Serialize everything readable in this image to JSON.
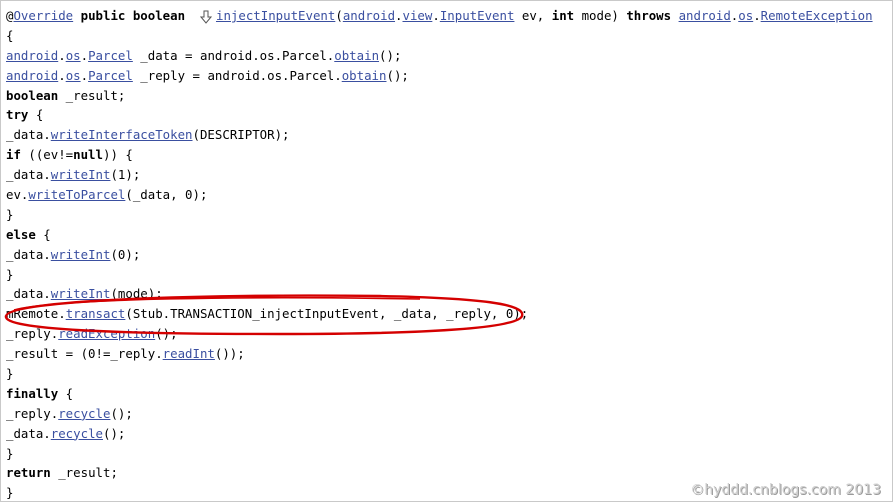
{
  "signature": {
    "annotation": "@",
    "override": "Override",
    "modifiers": "public boolean",
    "method": "injectInputEvent",
    "paren_open": "(",
    "param_pkg1": "android",
    "param_pkg2": "view",
    "param_type": "InputEvent",
    "param_rest": " ev, ",
    "int_kw": "int",
    "mode_param": " mode) ",
    "throws_kw": "throws",
    "exc_pkg1": "android",
    "exc_pkg2": "os",
    "exc_type": "RemoteException"
  },
  "code": {
    "open_brace": "{",
    "l2_pkg1": "android",
    "l2_pkg2": "os",
    "l2_type": "Parcel",
    "l2_rest": " _data = android.os.Parcel.",
    "l2_method": "obtain",
    "l2_end": "();",
    "l3_pkg1": "android",
    "l3_pkg2": "os",
    "l3_type": "Parcel",
    "l3_rest": " _reply = android.os.Parcel.",
    "l3_method": "obtain",
    "l3_end": "();",
    "l4_kw": "boolean",
    "l4_rest": " _result;",
    "l5_kw": "try",
    "l5_rest": " {",
    "l6_pre": "_data.",
    "l6_method": "writeInterfaceToken",
    "l6_rest": "(DESCRIPTOR);",
    "l7_kw": "if",
    "l7_mid": " ((ev!=",
    "l7_null": "null",
    "l7_rest": ")) {",
    "l8_pre": "_data.",
    "l8_method": "writeInt",
    "l8_rest": "(1);",
    "l9_pre": "ev.",
    "l9_method": "writeToParcel",
    "l9_rest": "(_data, 0);",
    "l10": "}",
    "l11_kw": "else",
    "l11_rest": " {",
    "l12_pre": "_data.",
    "l12_method": "writeInt",
    "l12_rest": "(0);",
    "l13": "}",
    "l14_pre": "_data.",
    "l14_method": "writeInt",
    "l14_rest": "(mode);",
    "l15_pre": "mRemote.",
    "l15_method": "transact",
    "l15_rest": "(Stub.TRANSACTION_injectInputEvent, _data, _reply, 0);",
    "l16_pre": "_reply.",
    "l16_method": "readException",
    "l16_rest": "();",
    "l17_pre": "_result = (0!=_reply.",
    "l17_method": "readInt",
    "l17_rest": "());",
    "l18": "}",
    "l19_kw": "finally",
    "l19_rest": " {",
    "l20_pre": "_reply.",
    "l20_method": "recycle",
    "l20_rest": "();",
    "l21_pre": "_data.",
    "l21_method": "recycle",
    "l21_rest": "();",
    "l22": "}",
    "l23_kw": "return",
    "l23_rest": " _result;",
    "l24": "}"
  },
  "watermark": "©hyddd.cnblogs.com 2013",
  "colors": {
    "link": "#3a4fa0",
    "highlight": "#d40000"
  },
  "icons": {
    "override_marker": "override-arrow-icon"
  }
}
